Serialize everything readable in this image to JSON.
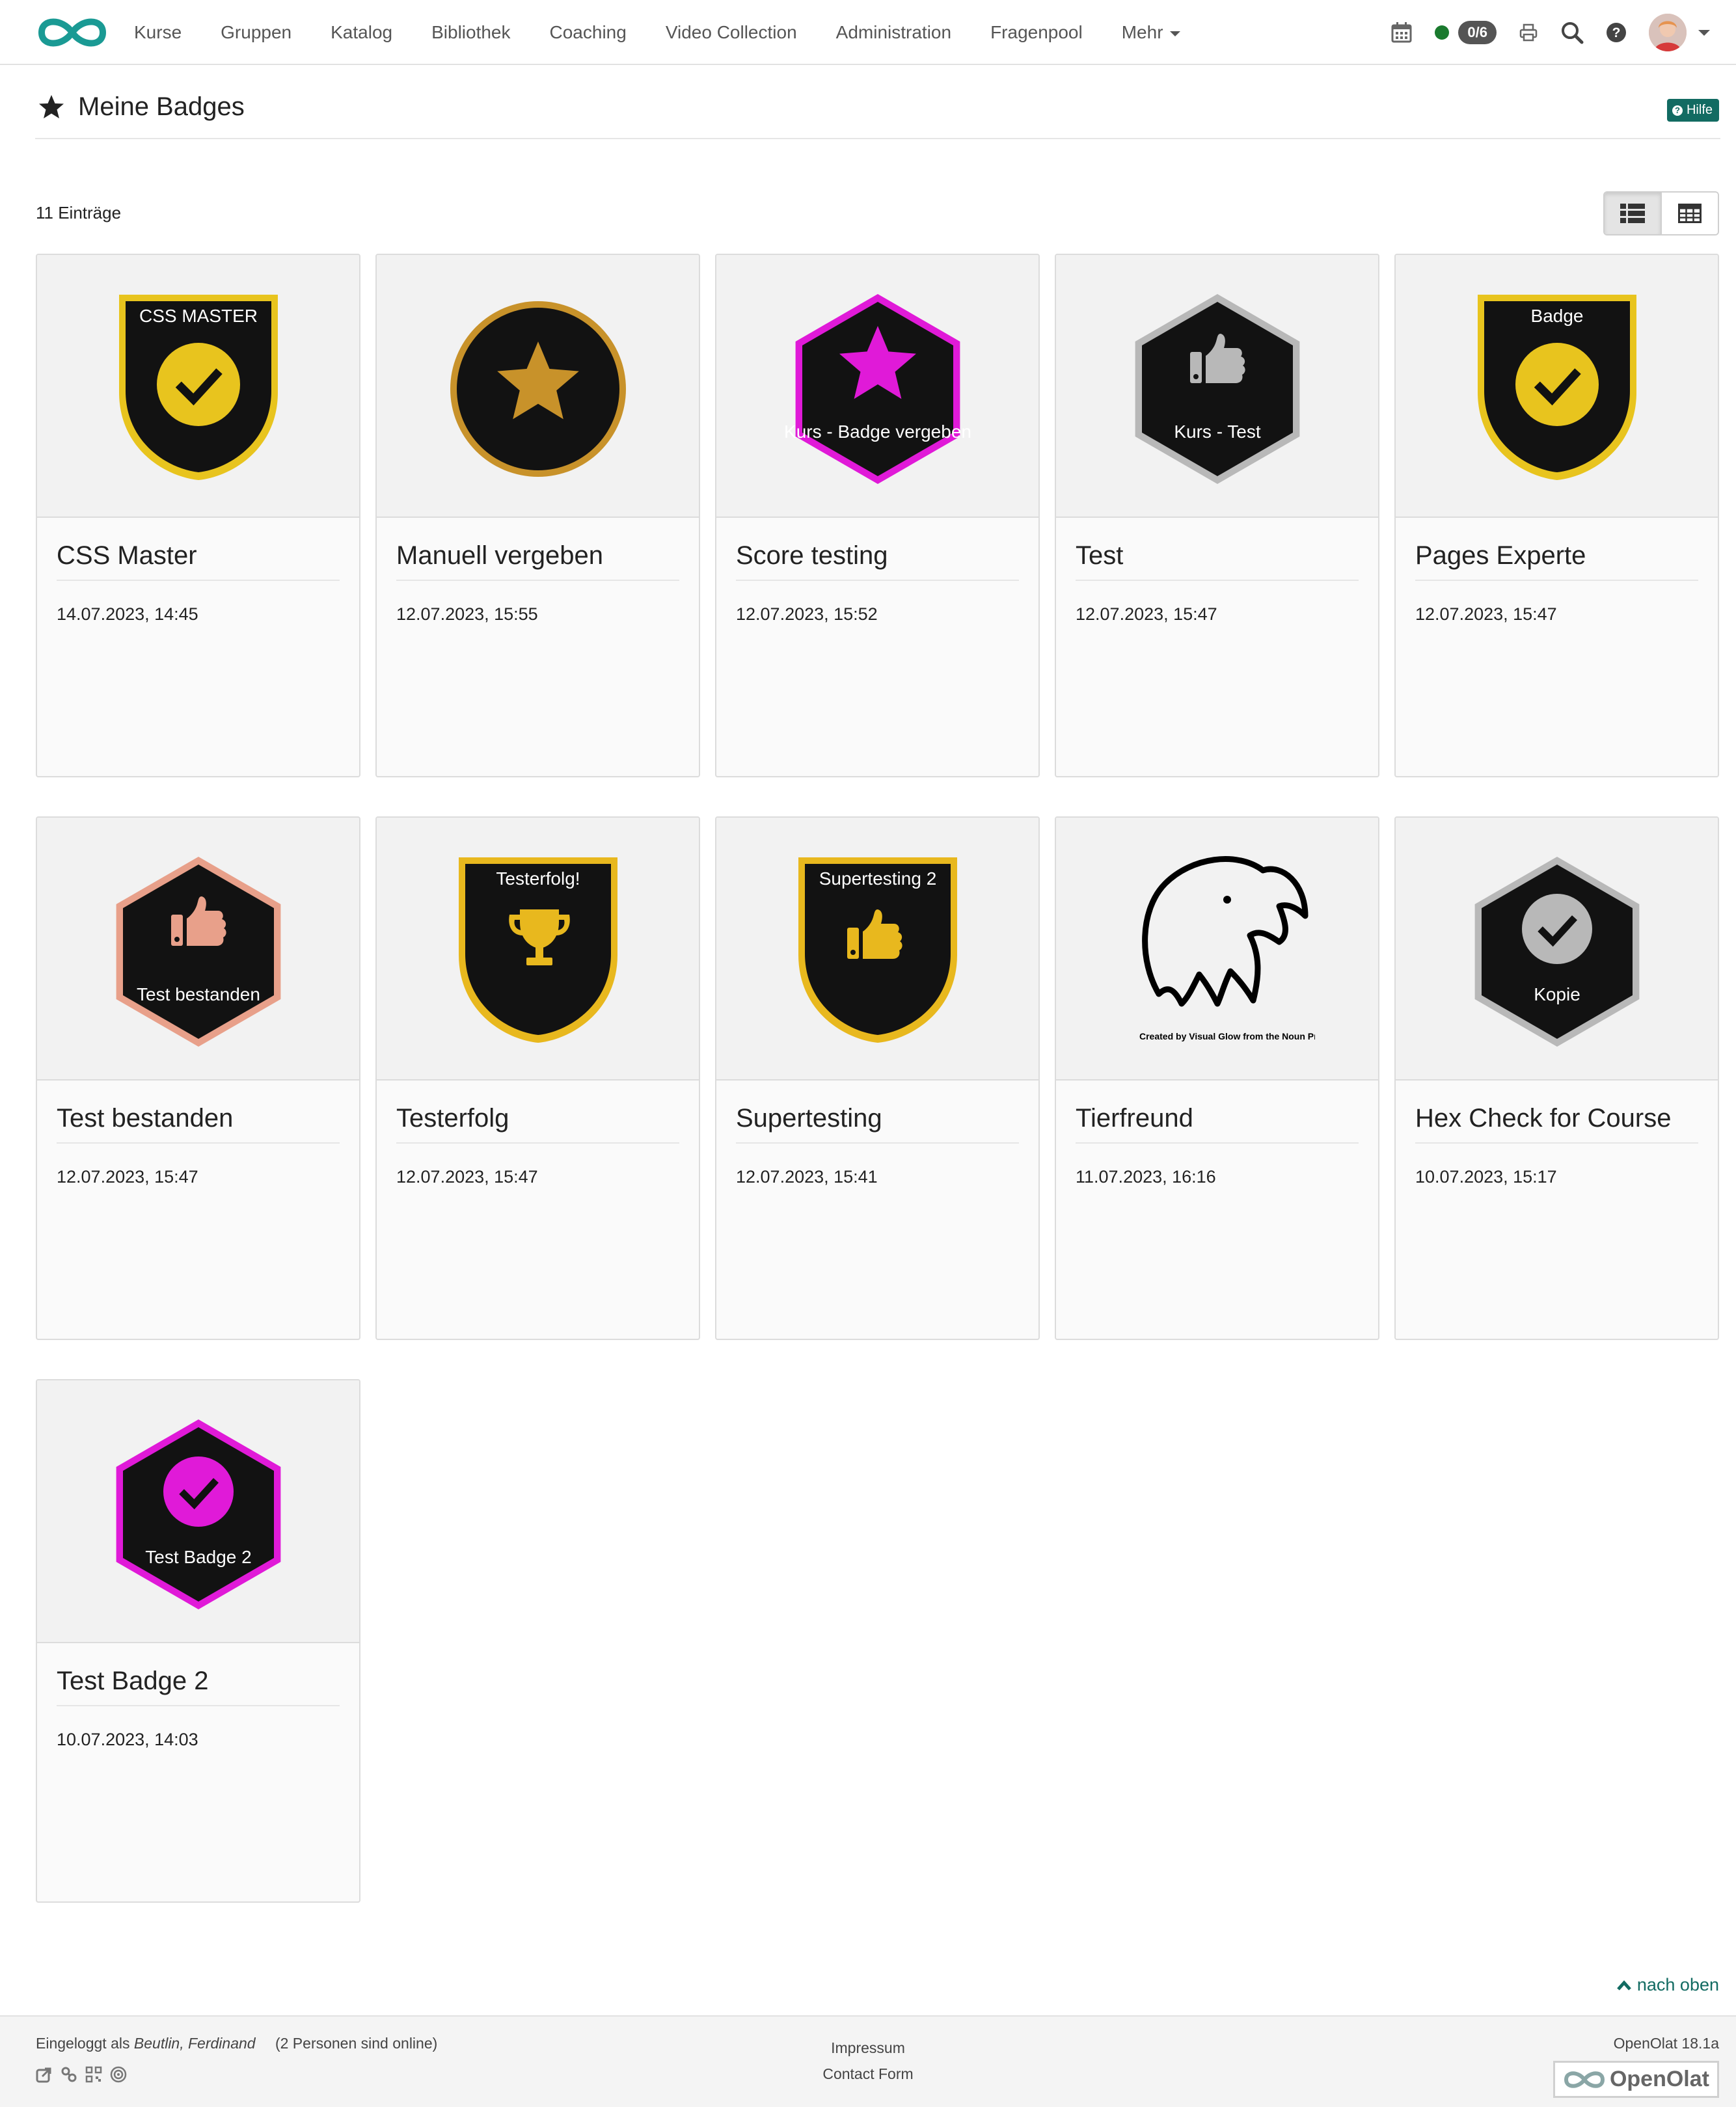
{
  "nav": {
    "items": [
      "Kurse",
      "Gruppen",
      "Katalog",
      "Bibliothek",
      "Coaching",
      "Video Collection",
      "Administration",
      "Fragenpool",
      "Mehr"
    ],
    "online_count": "0/6"
  },
  "page": {
    "title": "Meine Badges",
    "help_label": "Hilfe",
    "count_label": "11 Einträge"
  },
  "badges": [
    {
      "title": "CSS Master",
      "date": "14.07.2023, 14:45",
      "image_text": "CSS MASTER",
      "shape": "shield",
      "color": "#e8c41e",
      "icon": "check"
    },
    {
      "title": "Manuell vergeben",
      "date": "12.07.2023, 15:55",
      "image_text": "",
      "shape": "circle",
      "color": "#c8922a",
      "icon": "star"
    },
    {
      "title": "Score testing",
      "date": "12.07.2023, 15:52",
      "image_text": "Kurs - Badge vergeben",
      "shape": "hexagon",
      "color": "#e01ad8",
      "icon": "star"
    },
    {
      "title": "Test",
      "date": "12.07.2023, 15:47",
      "image_text": "Kurs - Test",
      "shape": "hexagon",
      "color": "#b8b8b8",
      "icon": "thumb"
    },
    {
      "title": "Pages Experte",
      "date": "12.07.2023, 15:47",
      "image_text": "Badge",
      "shape": "shield",
      "color": "#e8c41e",
      "icon": "check"
    },
    {
      "title": "Test bestanden",
      "date": "12.07.2023, 15:47",
      "image_text": "Test bestanden",
      "shape": "hexagon",
      "color": "#e8a08a",
      "icon": "thumb"
    },
    {
      "title": "Testerfolg",
      "date": "12.07.2023, 15:47",
      "image_text": "Testerfolg!",
      "shape": "shield",
      "color": "#e8b81e",
      "icon": "trophy"
    },
    {
      "title": "Supertesting",
      "date": "12.07.2023, 15:41",
      "image_text": "Supertesting 2",
      "shape": "shield",
      "color": "#e8b81e",
      "icon": "thumb"
    },
    {
      "title": "Tierfreund",
      "date": "11.07.2023, 16:16",
      "image_text": "Created by Visual Glow from the Noun Project",
      "shape": "eagle",
      "color": "#000000",
      "icon": "eagle"
    },
    {
      "title": "Hex Check for Course",
      "date": "10.07.2023, 15:17",
      "image_text": "Kopie",
      "shape": "hexagon",
      "color": "#b8b8b8",
      "icon": "check"
    },
    {
      "title": "Test Badge 2",
      "date": "10.07.2023, 14:03",
      "image_text": "Test Badge 2",
      "shape": "hexagon",
      "color": "#e01ad8",
      "icon": "check"
    }
  ],
  "footer": {
    "logged_in_prefix": "Eingeloggt als",
    "user_name": "Beutlin, Ferdinand",
    "online_text": "(2 Personen sind online)",
    "impressum": "Impressum",
    "contact": "Contact Form",
    "version": "OpenOlat 18.1a",
    "brand": "OpenOlat",
    "back_to_top": "nach oben"
  }
}
